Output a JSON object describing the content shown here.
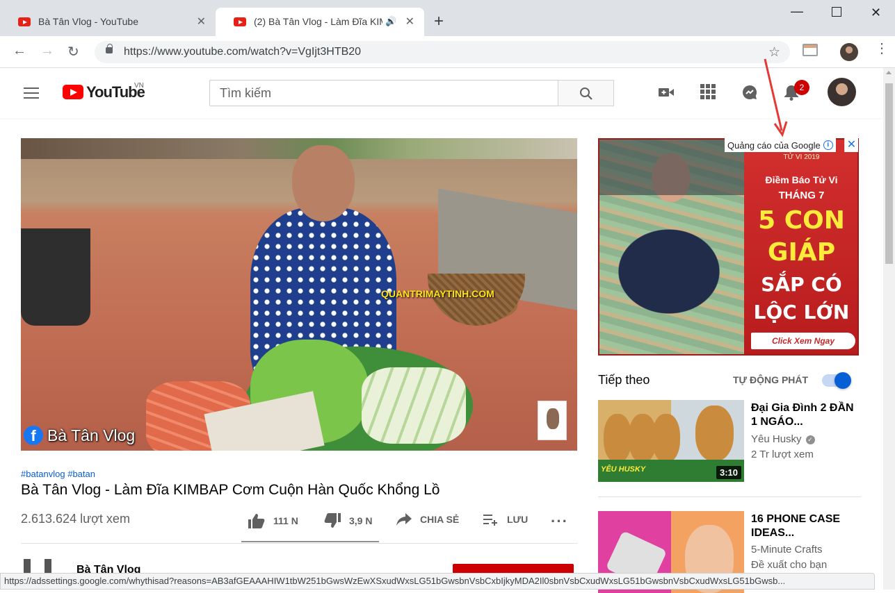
{
  "browser": {
    "tabs": [
      {
        "title": "Bà Tân Vlog - YouTube"
      },
      {
        "title": "(2) Bà Tân Vlog - Làm Đĩa KIMBAP"
      }
    ],
    "url": "https://www.youtube.com/watch?v=VgIjt3HTB20",
    "status_url": "https://adssettings.google.com/whythisad?reasons=AB3afGEAAAHIW1tbW251bGwsWzEwXSxudWxsLG51bGwsbnVsbCxbIjkyMDA2Il0sbnVsbCxudWxsLG51bGwsbnVsbCxudWxsLG51bGwsb..."
  },
  "youtube": {
    "wordmark": "YouTube",
    "country": "VN",
    "search_placeholder": "Tìm kiếm",
    "notification_count": "2"
  },
  "video": {
    "watermark": "QUANTRIMAYTINH.COM",
    "overlay_channel": "Bà Tân Vlog",
    "hashtags": "#batanvlog #batan",
    "title": "Bà Tân Vlog - Làm Đĩa KIMBAP Cơm Cuộn Hàn Quốc Khổng Lồ",
    "views": "2.613.624 lượt xem",
    "likes": "111 N",
    "dislikes": "3,9 N",
    "share_label": "CHIA SẺ",
    "save_label": "LƯU",
    "like_ratio": 0.97,
    "owner_name": "Bà Tân Vlog"
  },
  "ad": {
    "label": "Quảng cáo của Google",
    "small_text": "TỬ VI 2019",
    "line1": "Điềm Báo Tử Vi",
    "line2": "THÁNG 7",
    "big1": "5 CON",
    "big2": "GIÁP",
    "line3": "SẮP CÓ",
    "line4": "LỘC LỚN",
    "cta": "Click Xem Ngay"
  },
  "up_next": {
    "title": "Tiếp theo",
    "autoplay_label": "TỰ ĐỘNG PHÁT",
    "autoplay_on": true,
    "items": [
      {
        "title": "Đại Gia Đình 2 ĐẦN 1 NGÁO...",
        "channel": "Yêu Husky",
        "meta": "2 Tr lượt xem",
        "duration": "3:10",
        "brand": "YÊU HUSKY"
      },
      {
        "title": "16 PHONE CASE IDEAS...",
        "channel": "5-Minute Crafts",
        "meta": "Đề xuất cho bạn"
      }
    ]
  },
  "colors": {
    "youtube_red": "#ff0000",
    "link_blue": "#065fd4",
    "badge_red": "#cc0000",
    "arrow_red": "#e53935"
  }
}
